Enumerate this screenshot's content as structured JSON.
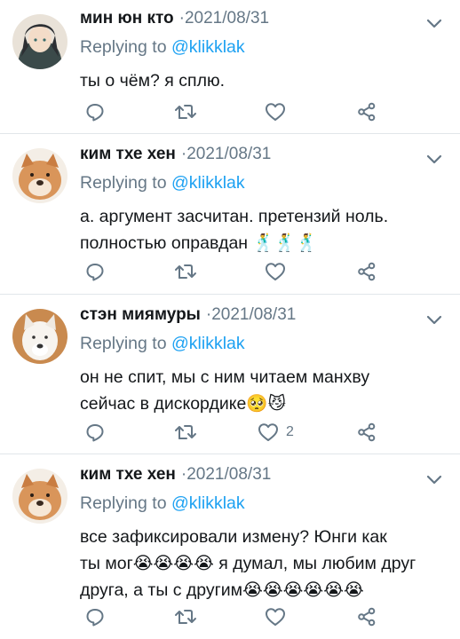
{
  "colors": {
    "accent": "#1da1f2",
    "muted": "#657786",
    "text": "#14171a",
    "divider": "#e1e6ea"
  },
  "tweets": [
    {
      "name": "мин юн кто",
      "date": "2021/08/31",
      "replying_prefix": "Replying to",
      "handle": "@klikklak",
      "lines": [
        "ты о чём? я сплю."
      ],
      "like_count": ""
    },
    {
      "name": "ким тхе хен",
      "date": "2021/08/31",
      "replying_prefix": "Replying to",
      "handle": "@klikklak",
      "lines": [
        "а. аргумент засчитан. претензий ноль.",
        "полностью оправдан 🕺🕺🕺"
      ],
      "like_count": ""
    },
    {
      "name": "стэн миямуры",
      "date": "2021/08/31",
      "replying_prefix": "Replying to",
      "handle": "@klikklak",
      "lines": [
        "он не спит, мы с ним читаем манхву",
        "сейчас в дискордике🥺😼"
      ],
      "like_count": "2"
    },
    {
      "name": "ким тхе хен",
      "date": "2021/08/31",
      "replying_prefix": "Replying to",
      "handle": "@klikklak",
      "lines": [
        "все зафиксировали измену? Юнги как",
        "ты мог😭😭😭😭 я думал, мы любим друг",
        "друга, а ты с другим😭😭😭😭😭😭"
      ],
      "like_count": ""
    }
  ]
}
